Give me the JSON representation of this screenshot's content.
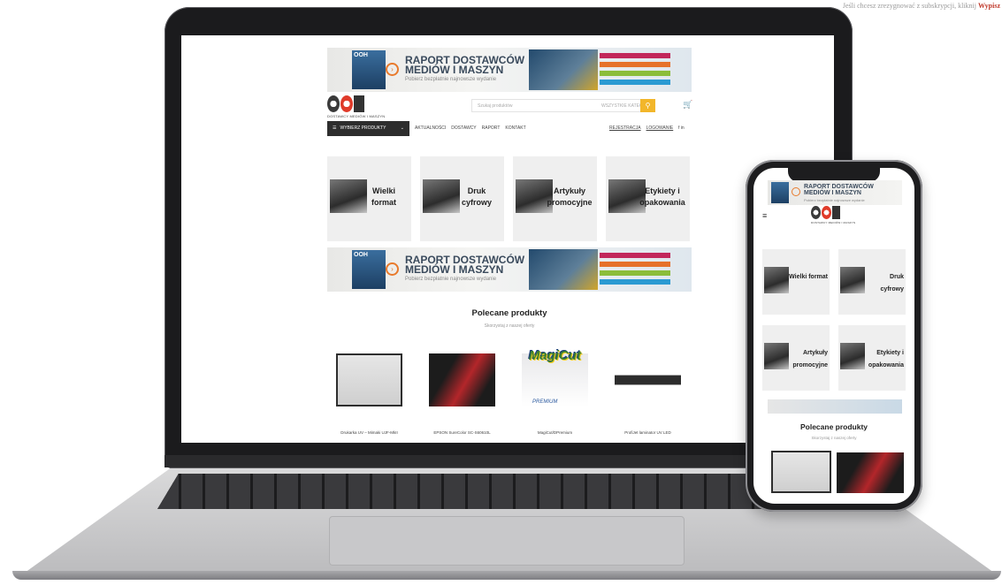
{
  "corner": {
    "text": "Jeśli chcesz zrezygnować z subskrypcji, kliknij",
    "link": "Wypisz"
  },
  "banner": {
    "magazine": "OOH",
    "title": "RAPORT DOSTAWCÓW MEDIÓW I MASZYN",
    "subtitle": "Pobierz bezpłatnie najnowsze wydanie"
  },
  "header": {
    "logo_sub": "DOSTAWCY MEDIÓW I MASZYN",
    "search_placeholder": "Szukaj produktów",
    "search_category": "WSZYSTKIE KATEGORIE",
    "cart_icon": "cart-icon"
  },
  "nav": {
    "categories_label": "WYBIERZ PRODUKTY",
    "links": [
      "AKTUALNOŚCI",
      "DOSTAWCY",
      "RAPORT",
      "KONTAKT"
    ],
    "register": "REJESTRACJA",
    "login": "LOGOWANIE",
    "social": "f   in"
  },
  "categories": [
    "Wielki format",
    "Druk cyfrowy",
    "Artykuły promocyjne",
    "Etykiety i opakowania"
  ],
  "featured": {
    "title": "Polecane produkty",
    "subtitle": "Skorzystaj z naszej oferty",
    "products": [
      "Drukarka UV – Mimaki UJF-MkII",
      "EPSON SureColor SC-S60610L",
      "MagiCut/DPremium",
      "ProfiJet laminator UV LED"
    ]
  },
  "magiccut_logo": "MagiCut",
  "magiccut_premium": "PREMIUM",
  "phone": {
    "menu_icon": "hamburger-icon"
  }
}
